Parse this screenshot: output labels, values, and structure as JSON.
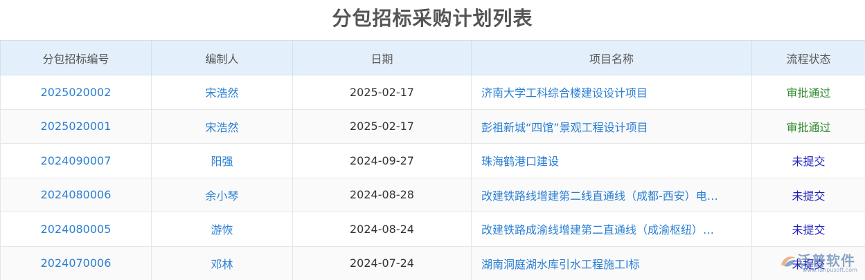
{
  "page": {
    "title": "分包招标采购计划列表"
  },
  "table": {
    "columns": [
      "分包招标编号",
      "编制人",
      "日期",
      "项目名称",
      "流程状态"
    ],
    "rows": [
      {
        "code": "2025020002",
        "author": "宋浩然",
        "date": "2025-02-17",
        "project": "济南大学工科综合楼建设设计项目",
        "status": "审批通过",
        "status_color": "#2e8b2e"
      },
      {
        "code": "2025020001",
        "author": "宋浩然",
        "date": "2025-02-17",
        "project": "彭祖新城“四馆”景观工程设计项目",
        "status": "审批通过",
        "status_color": "#2e8b2e"
      },
      {
        "code": "2024090007",
        "author": "阳强",
        "date": "2024-09-27",
        "project": "珠海鹤港口建设",
        "status": "未提交",
        "status_color": "#1f1fbf"
      },
      {
        "code": "2024080006",
        "author": "余小琴",
        "date": "2024-08-28",
        "project": "改建铁路线增建第二线直通线（成都-西安）电…",
        "status": "未提交",
        "status_color": "#1f1fbf"
      },
      {
        "code": "2024080005",
        "author": "游恢",
        "date": "2024-08-24",
        "project": "改建铁路成渝线增建第二直通线（成渝枢纽）…",
        "status": "未提交",
        "status_color": "#1f1fbf"
      },
      {
        "code": "2024070006",
        "author": "邓林",
        "date": "2024-07-24",
        "project": "湖南洞庭湖水库引水工程施工I标",
        "status": "未提交",
        "status_color": "#1f1fbf"
      }
    ]
  },
  "watermark": {
    "text": "泛普软件",
    "sub": "www.fanpusoft.com"
  },
  "colors": {
    "link": "#2a7fd4",
    "header_bg": "#e3effa",
    "approved": "#2e8b2e",
    "unsubmitted": "#1f1fbf"
  }
}
